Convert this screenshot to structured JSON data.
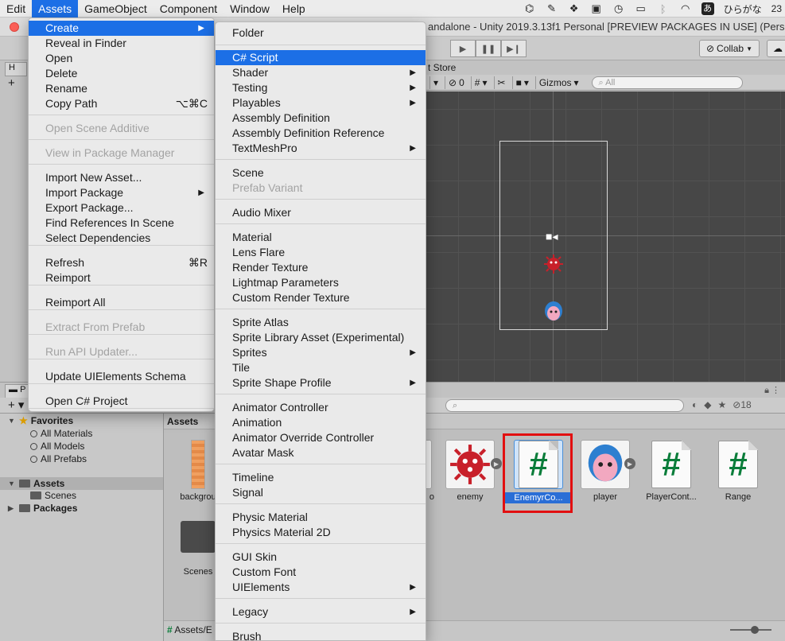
{
  "menubar": {
    "items": [
      "Edit",
      "Assets",
      "GameObject",
      "Component",
      "Window",
      "Help"
    ],
    "active_index": 1,
    "tray_ime": "ひらがな",
    "tray_kana": "あ",
    "tray_clock": "23"
  },
  "window": {
    "title": "andalone - Unity 2019.3.13f1 Personal [PREVIEW PACKAGES IN USE] (Perso"
  },
  "toolbar": {
    "collab_label": "Collab",
    "asset_store_tab": "t Store"
  },
  "hierarchy": {
    "tab_label": "H"
  },
  "scene": {
    "gizmos_label": "Gizmos",
    "search_placeholder": "All",
    "hidden_count": "0"
  },
  "project": {
    "tab_label": "P",
    "search_placeholder": "",
    "count_badge": "18",
    "tree": {
      "favorites": "Favorites",
      "fav_items": [
        "All Materials",
        "All Models",
        "All Prefabs"
      ],
      "assets": "Assets",
      "scenes": "Scenes",
      "packages": "Packages"
    },
    "header": "Assets",
    "assets": [
      {
        "label": "backgrou",
        "kind": "sprite"
      },
      {
        "label": "Scenes",
        "kind": "folder"
      },
      {
        "label": "enemy",
        "kind": "prefab-enemy"
      },
      {
        "label": "EnemyrCo...",
        "kind": "script",
        "selected": true
      },
      {
        "label": "player",
        "kind": "prefab-player"
      },
      {
        "label": "PlayerCont...",
        "kind": "script"
      },
      {
        "label": "Range",
        "kind": "script"
      }
    ],
    "partial_label": "o",
    "script_glyph": "#",
    "status_path": "Assets/E"
  },
  "assets_menu": {
    "items": [
      {
        "label": "Create",
        "highlighted": true,
        "submenu": true
      },
      {
        "label": "Reveal in Finder"
      },
      {
        "label": "Open"
      },
      {
        "label": "Delete"
      },
      {
        "label": "Rename"
      },
      {
        "label": "Copy Path",
        "shortcut": "⌥⌘C"
      },
      {
        "label": "Open Scene Additive",
        "disabled": true
      },
      {
        "label": "View in Package Manager",
        "disabled": true
      },
      {
        "label": "Import New Asset..."
      },
      {
        "label": "Import Package",
        "submenu": true
      },
      {
        "label": "Export Package..."
      },
      {
        "label": "Find References In Scene"
      },
      {
        "label": "Select Dependencies"
      },
      {
        "label": "Refresh",
        "shortcut": "⌘R"
      },
      {
        "label": "Reimport"
      },
      {
        "label": "Reimport All"
      },
      {
        "label": "Extract From Prefab",
        "disabled": true
      },
      {
        "label": "Run API Updater...",
        "disabled": true
      },
      {
        "label": "Update UIElements Schema"
      },
      {
        "label": "Open C# Project"
      }
    ]
  },
  "create_menu": {
    "items": [
      {
        "label": "Folder"
      },
      {
        "label": "C# Script",
        "highlighted": true
      },
      {
        "label": "Shader",
        "submenu": true
      },
      {
        "label": "Testing",
        "submenu": true
      },
      {
        "label": "Playables",
        "submenu": true
      },
      {
        "label": "Assembly Definition"
      },
      {
        "label": "Assembly Definition Reference"
      },
      {
        "label": "TextMeshPro",
        "submenu": true
      },
      {
        "label": "Scene"
      },
      {
        "label": "Prefab Variant",
        "disabled": true
      },
      {
        "label": "Audio Mixer"
      },
      {
        "label": "Material"
      },
      {
        "label": "Lens Flare"
      },
      {
        "label": "Render Texture"
      },
      {
        "label": "Lightmap Parameters"
      },
      {
        "label": "Custom Render Texture"
      },
      {
        "label": "Sprite Atlas"
      },
      {
        "label": "Sprite Library Asset (Experimental)"
      },
      {
        "label": "Sprites",
        "submenu": true
      },
      {
        "label": "Tile"
      },
      {
        "label": "Sprite Shape Profile",
        "submenu": true
      },
      {
        "label": "Animator Controller"
      },
      {
        "label": "Animation"
      },
      {
        "label": "Animator Override Controller"
      },
      {
        "label": "Avatar Mask"
      },
      {
        "label": "Timeline"
      },
      {
        "label": "Signal"
      },
      {
        "label": "Physic Material"
      },
      {
        "label": "Physics Material 2D"
      },
      {
        "label": "GUI Skin"
      },
      {
        "label": "Custom Font"
      },
      {
        "label": "UIElements",
        "submenu": true
      },
      {
        "label": "Legacy",
        "submenu": true
      },
      {
        "label": "Brush"
      }
    ]
  },
  "colors": {
    "menu_highlight": "#1c6fe6",
    "selection_box": "#e20f10",
    "script_hash": "#0a7d3a"
  }
}
